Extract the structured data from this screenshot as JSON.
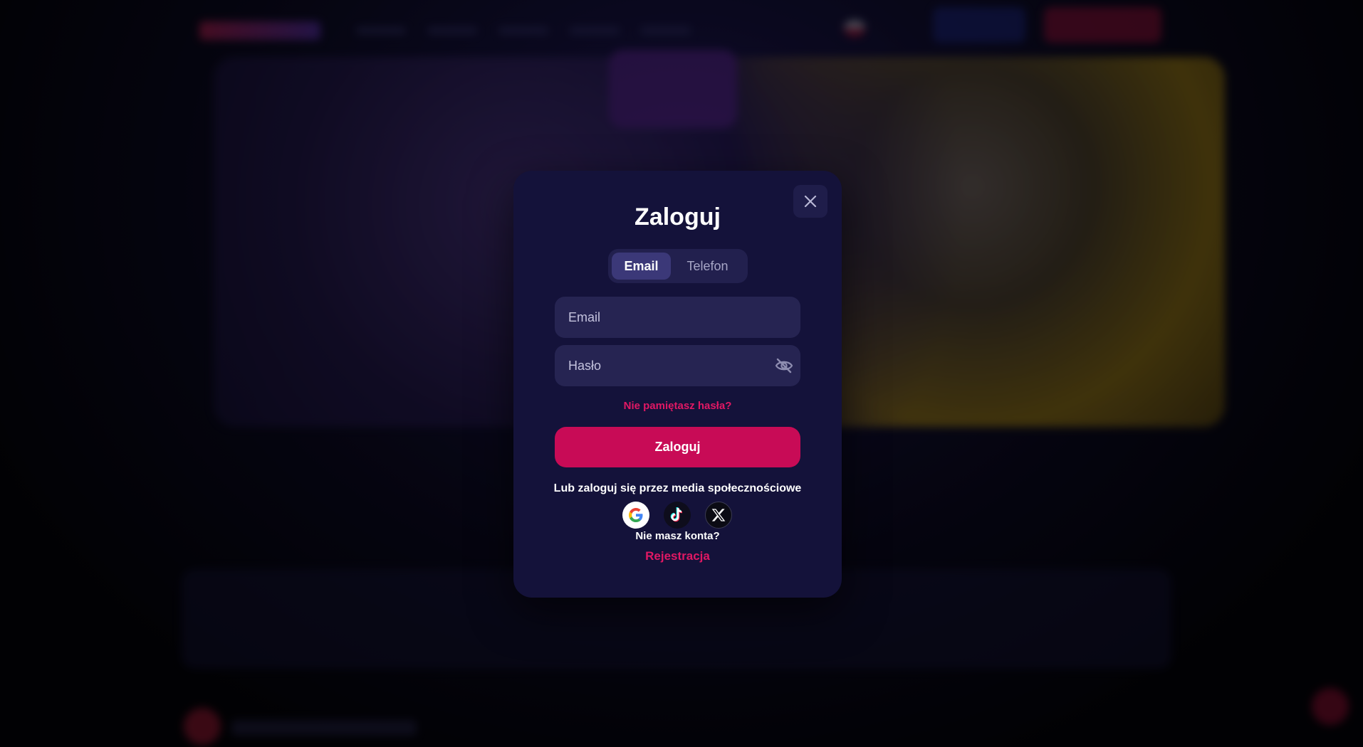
{
  "modal": {
    "title": "Zaloguj",
    "tabs": [
      {
        "label": "Email",
        "active": true
      },
      {
        "label": "Telefon",
        "active": false
      }
    ],
    "email_field": {
      "placeholder": "Email",
      "value": ""
    },
    "password_field": {
      "placeholder": "Hasło",
      "value": "",
      "toggle_icon": "eye-off-icon"
    },
    "forgot_password": "Nie pamiętasz hasła?",
    "submit_label": "Zaloguj",
    "social_prompt": "Lub zaloguj się przez media społecznościowe",
    "social_providers": [
      {
        "name": "Google",
        "icon": "google-icon"
      },
      {
        "name": "TikTok",
        "icon": "tiktok-icon"
      },
      {
        "name": "X",
        "icon": "x-icon"
      }
    ],
    "no_account": "Nie masz konta?",
    "register_label": "Rejestracja",
    "close_icon": "close-icon"
  },
  "colors": {
    "modal_bg": "#14123a",
    "accent": "#c80b56",
    "link": "#e11864",
    "input_bg": "#262452",
    "tab_active_bg": "#3b3878"
  }
}
